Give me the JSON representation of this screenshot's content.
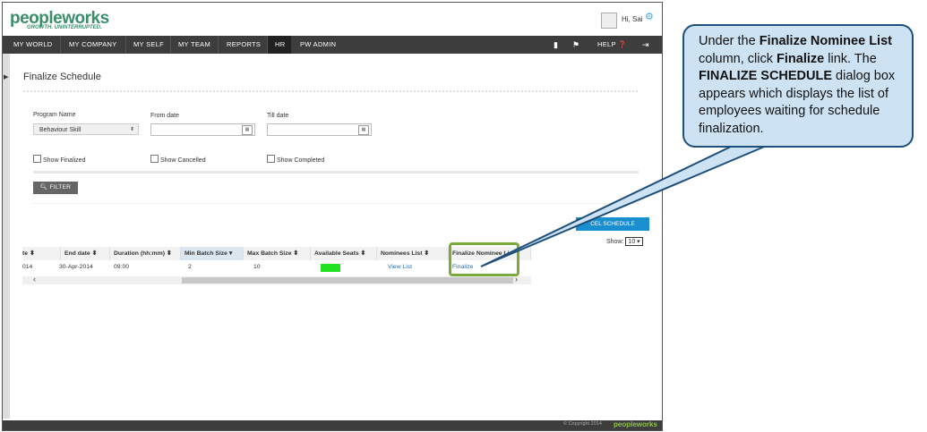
{
  "header": {
    "logo_main": "peopleworks",
    "logo_tagline": "GROWTH. UNINTERRUPTED.",
    "greeting": "Hi, Sai",
    "gear_icon": "gear-icon"
  },
  "nav": {
    "items": [
      "MY WORLD",
      "MY COMPANY",
      "MY SELF",
      "MY TEAM",
      "REPORTS",
      "HR",
      "PW ADMIN"
    ],
    "active": "HR",
    "help_label": "HELP"
  },
  "page": {
    "title": "Finalize Schedule"
  },
  "filters": {
    "program_label": "Program Name",
    "program_value": "Behaviour Skill",
    "from_label": "From date",
    "till_label": "Till date",
    "show_finalized": "Show Finalized",
    "show_cancelled": "Show Cancelled",
    "show_completed": "Show Completed",
    "filter_button": "FILTER"
  },
  "actions": {
    "cancel_schedule": "CEL SCHEDULE",
    "show_label": "Show:",
    "show_value": "10"
  },
  "table": {
    "headers": [
      "te",
      "End date",
      "Duration (hh:mm)",
      "Min Batch Size",
      "Max Batch Size",
      "Available Seats",
      "Nominees List",
      "Finalize Nominee Li"
    ],
    "row": {
      "start_date": "014",
      "end_date": "30-Apr-2014",
      "duration": "09:00",
      "min_batch": "2",
      "max_batch": "10",
      "nominees_link": "View List",
      "finalize_link": "Finalize"
    },
    "seat_color": "#22e022"
  },
  "footer": {
    "copyright": "© Copyright 2014",
    "logo": "peopleworks"
  },
  "callout": {
    "t1": "Under the ",
    "b1": "Finalize Nominee List",
    "t2": " column, click ",
    "b2": "Finalize",
    "t3": " link. The ",
    "b3": "FINALIZE SCHEDULE",
    "t4": " dialog box appears which displays the list of employees waiting for schedule finalization."
  }
}
